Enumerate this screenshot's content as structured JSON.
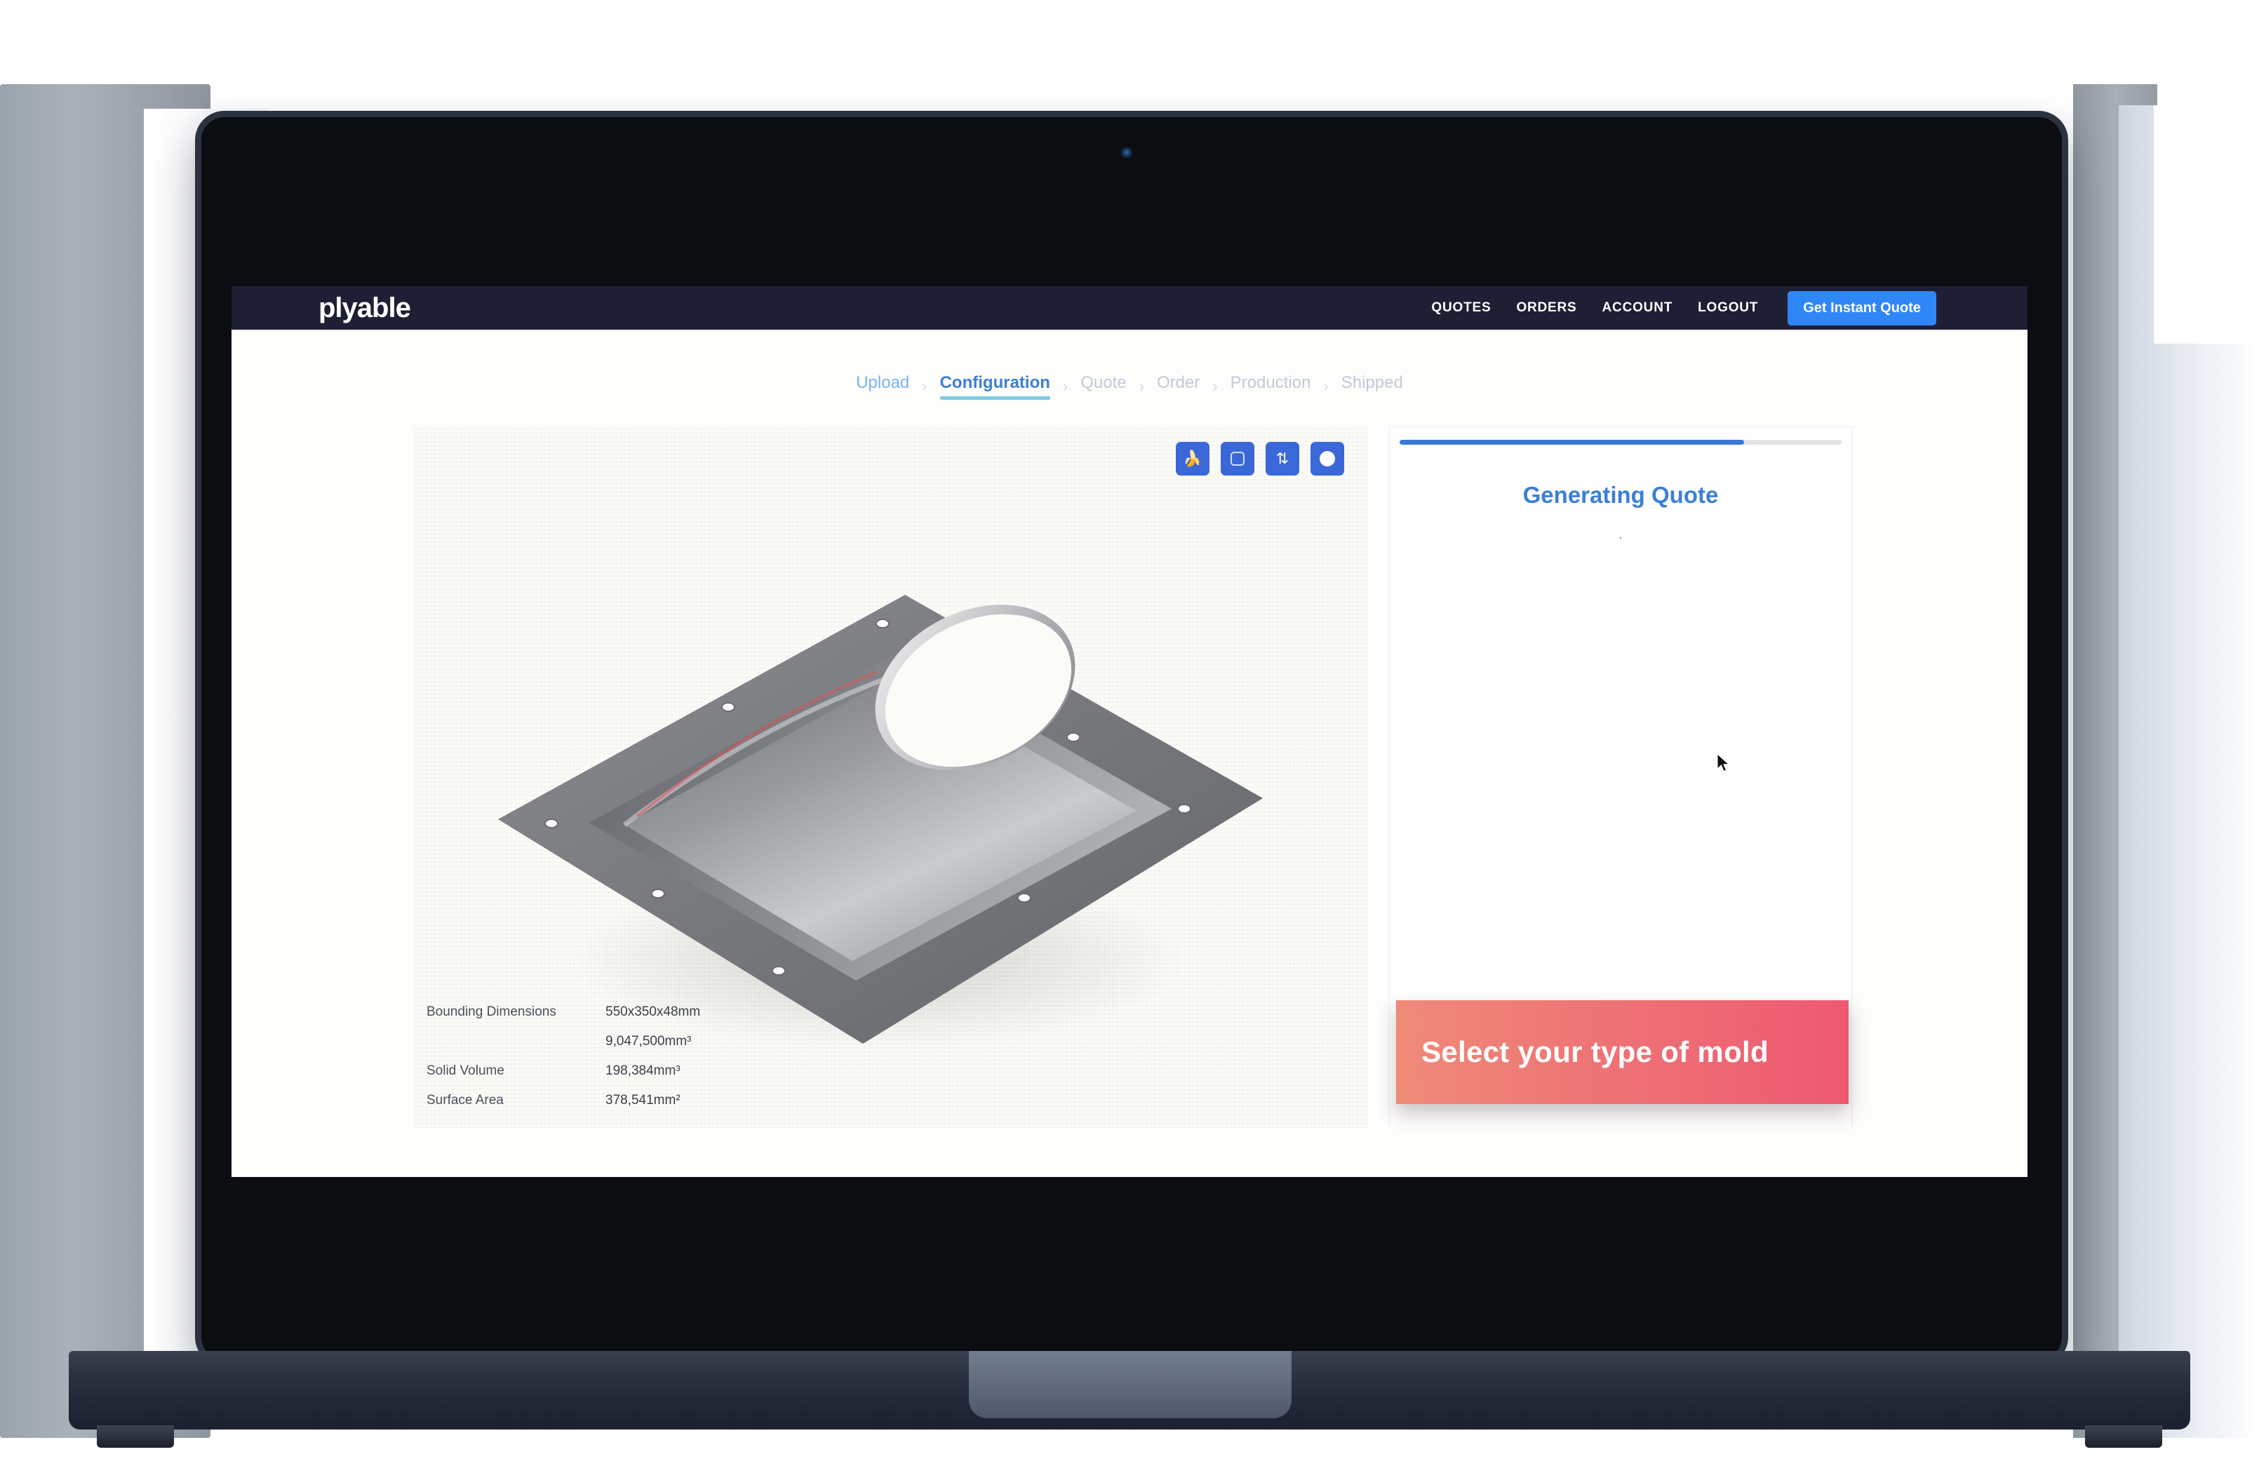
{
  "header": {
    "brand": "plyable",
    "nav": [
      {
        "label": "QUOTES",
        "name": "nav-quotes"
      },
      {
        "label": "ORDERS",
        "name": "nav-orders"
      },
      {
        "label": "ACCOUNT",
        "name": "nav-account"
      },
      {
        "label": "LOGOUT",
        "name": "nav-logout"
      }
    ],
    "cta_label": "Get Instant Quote",
    "background_color": "#1e1e34",
    "cta_color": "#2f86f6"
  },
  "breadcrumb": {
    "separator": "›",
    "steps": [
      {
        "label": "Upload",
        "state": "done"
      },
      {
        "label": "Configuration",
        "state": "active"
      },
      {
        "label": "Quote",
        "state": "upcoming"
      },
      {
        "label": "Order",
        "state": "upcoming"
      },
      {
        "label": "Production",
        "state": "upcoming"
      },
      {
        "label": "Shipped",
        "state": "upcoming"
      }
    ]
  },
  "viewer": {
    "toolbar": [
      {
        "icon": "banana-icon",
        "glyph": "🍌"
      },
      {
        "icon": "square-outline-icon",
        "glyph": ""
      },
      {
        "icon": "updown-arrows-icon",
        "glyph": "⇅"
      },
      {
        "icon": "filled-circle-icon",
        "glyph": ""
      }
    ],
    "model_name": "mold-part-3d-model"
  },
  "specs": {
    "rows": [
      {
        "label": "Bounding Dimensions",
        "value": "550x350x48mm"
      },
      {
        "label": "",
        "value": "9,047,500mm³"
      },
      {
        "label": "Solid Volume",
        "value": "198,384mm³"
      },
      {
        "label": "Surface Area",
        "value": "378,541mm²"
      }
    ]
  },
  "quote_panel": {
    "status_text": "Generating Quote",
    "spinner": "·",
    "progress_percent": 78,
    "progress_color": "#3a78d8"
  },
  "callout": {
    "text": "Select your type of mold",
    "gradient_start": "#ef8a78",
    "gradient_end": "#ee5972"
  }
}
